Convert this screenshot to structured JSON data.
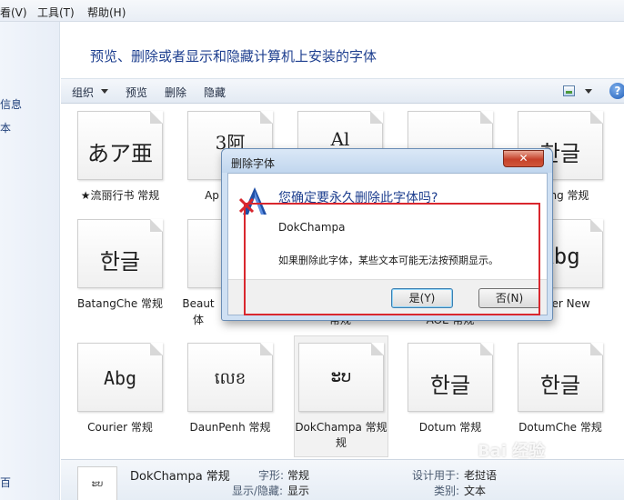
{
  "menubar": {
    "view": "看(V)",
    "tools": "工具(T)",
    "help": "帮助(H)"
  },
  "navpane": {
    "item1": "信息",
    "item2": "本",
    "item3": "百"
  },
  "header": {
    "title": "预览、删除或者显示和隐藏计算机上安装的字体"
  },
  "toolbar": {
    "organize": "组织",
    "preview": "预览",
    "delete": "删除",
    "hide": "隐藏",
    "help_glyph": "?"
  },
  "tiles": [
    {
      "sample": "あア亜",
      "name": "★流丽行书 常规"
    },
    {
      "sample": "3阿",
      "name": "Ap"
    },
    {
      "sample": "Al",
      "name": ""
    },
    {
      "sample": "",
      "name": ""
    },
    {
      "sample": "한글",
      "name": "ng 常规"
    },
    {
      "sample": "한글",
      "name": "BatangChe 常规"
    },
    {
      "sample": "",
      "name": "Beaut"
    },
    {
      "sample": "",
      "name": "常规"
    },
    {
      "sample": "",
      "name": "AOE 常规"
    },
    {
      "sample": "Abg",
      "name": "ier New"
    },
    {
      "sample": "Abg",
      "name": "Courier 常规"
    },
    {
      "sample": "លេខ",
      "name": "DaunPenh 常规"
    },
    {
      "sample": "ະບ",
      "name": "DokChampa 常规"
    },
    {
      "sample": "한글",
      "name": "Dotum 常规"
    },
    {
      "sample": "한글",
      "name": "DotumChe 常规"
    }
  ],
  "tile_extra": {
    "beaut_suffix": "体",
    "dok_suffix": "规"
  },
  "details": {
    "thumb": "ະບ",
    "font_name": "DokChampa 常规",
    "style_label": "字形:",
    "style_value": "常规",
    "showhide_label": "显示/隐藏:",
    "showhide_value": "显示",
    "designed_label": "设计用于:",
    "designed_value": "老挝语",
    "category_label": "类别:",
    "category_value": "文本"
  },
  "dialog": {
    "title": "删除字体",
    "close": "✕",
    "question": "您确定要永久删除此字体吗?",
    "font_name": "DokChampa",
    "message": "如果删除此字体，某些文本可能无法按预期显示。",
    "yes": "是(Y)",
    "no": "否(N)"
  },
  "watermark": "Bai  经验",
  "colors": {
    "title_blue": "#1e3f8f",
    "highlight_red": "#d9272e",
    "close_red": "#c6412a"
  }
}
